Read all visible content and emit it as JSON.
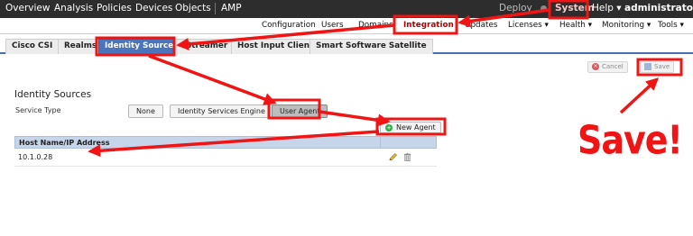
{
  "topnav": {
    "items": [
      "Overview",
      "Analysis",
      "Policies",
      "Devices",
      "Objects",
      "AMP"
    ],
    "deploy": "Deploy",
    "system": "System",
    "help": "Help ▾",
    "user": "administrator ▾"
  },
  "subnav": {
    "items": [
      "Configuration",
      "Users",
      "Domains",
      "Integration",
      "Updates",
      "Licenses ▾",
      "Health ▾",
      "Monitoring ▾",
      "Tools ▾"
    ]
  },
  "tabs": [
    "Cisco CSI",
    "Realms",
    "Identity Sources",
    "eStreamer",
    "Host Input Client",
    "Smart Software Satellite"
  ],
  "actions": {
    "cancel": "Cancel",
    "save": "Save"
  },
  "identity": {
    "title": "Identity Sources",
    "service_type_label": "Service Type",
    "options": [
      "None",
      "Identity Services Engine",
      "User Agent"
    ],
    "selected": "User Agent",
    "new_agent": "New Agent"
  },
  "table": {
    "header": "Host Name/IP Address",
    "rows": [
      "10.1.0.28"
    ]
  },
  "annotation": {
    "text": "Save!",
    "color": "#f01414"
  }
}
